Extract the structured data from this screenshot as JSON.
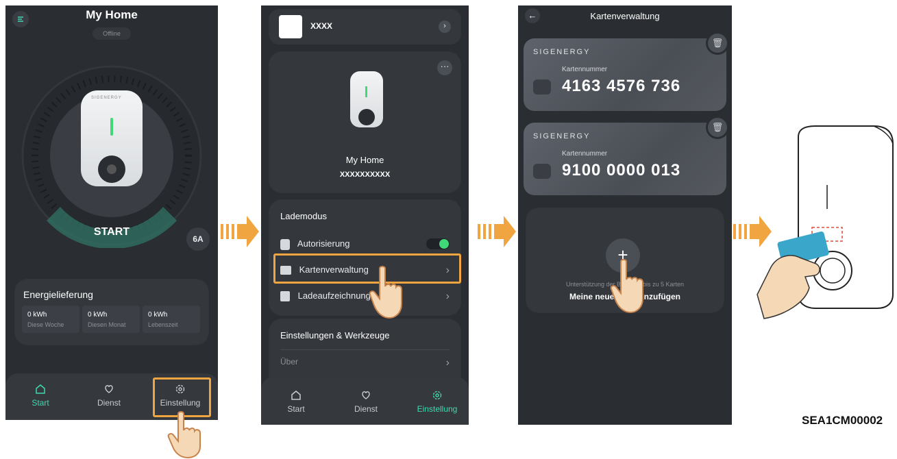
{
  "phone1": {
    "title": "My Home",
    "status": "Offline",
    "start_button": "START",
    "current_badge": "6A",
    "energy": {
      "title": "Energielieferung",
      "cells": [
        {
          "value": "0 kWh",
          "label": "Diese Woche"
        },
        {
          "value": "0 kWh",
          "label": "Diesen Monat"
        },
        {
          "value": "0 kWh",
          "label": "Lebenszeit"
        }
      ]
    },
    "tabs": {
      "start": "Start",
      "dienst": "Dienst",
      "einstellung": "Einstellung"
    }
  },
  "phone2": {
    "device_name": "XXXX",
    "charger_name": "My Home",
    "serial": "XXXXXXXXXX",
    "section1_title": "Lademodus",
    "rows": {
      "autorisierung": "Autorisierung",
      "kartenverwaltung": "Kartenverwaltung",
      "ladeaufzeichnung": "Ladeaufzeichnung"
    },
    "section2_title": "Einstellungen & Werkzeuge",
    "about": "Über",
    "tabs": {
      "start": "Start",
      "dienst": "Dienst",
      "einstellung": "Einstellung"
    }
  },
  "phone3": {
    "title": "Kartenverwaltung",
    "cards": [
      {
        "brand": "SIGENERGY",
        "label": "Kartennummer",
        "number": "4163 4576 736"
      },
      {
        "brand": "SIGENERGY",
        "label": "Kartennummer",
        "number": "9100 0000 013"
      }
    ],
    "add_hint": "Unterstützung der Bi         n bis zu 5 Karten",
    "add_label": "Meine neue            inzufügen"
  },
  "figure_code": "SEA1CM00002",
  "colors": {
    "accent": "#3fd9b0",
    "highlight": "#f0a540",
    "phone_bg": "#2a2d31"
  }
}
